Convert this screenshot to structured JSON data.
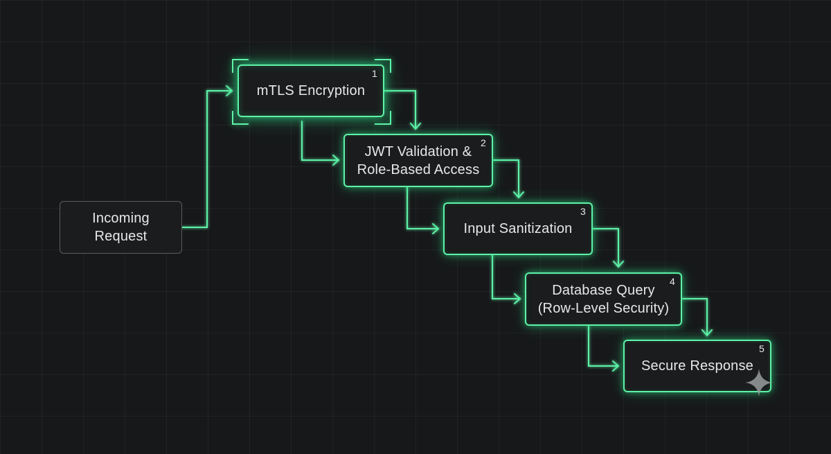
{
  "diagram": {
    "nodes": [
      {
        "id": "incoming",
        "label": "Incoming\nRequest",
        "number": ""
      },
      {
        "id": "mtls",
        "label": "mTLS Encryption",
        "number": "1"
      },
      {
        "id": "jwt",
        "label": "JWT Validation &\nRole-Based Access",
        "number": "2"
      },
      {
        "id": "sanitize",
        "label": "Input Sanitization",
        "number": "3"
      },
      {
        "id": "db",
        "label": "Database Query\n(Row-Level Security)",
        "number": "4"
      },
      {
        "id": "response",
        "label": "Secure Response",
        "number": "5"
      }
    ],
    "edges": [
      {
        "from": "incoming",
        "to": "mtls"
      },
      {
        "from": "mtls",
        "to": "jwt"
      },
      {
        "from": "mtls",
        "to": "jwt"
      },
      {
        "from": "jwt",
        "to": "sanitize"
      },
      {
        "from": "jwt",
        "to": "sanitize"
      },
      {
        "from": "sanitize",
        "to": "db"
      },
      {
        "from": "sanitize",
        "to": "db"
      },
      {
        "from": "db",
        "to": "response"
      },
      {
        "from": "db",
        "to": "response"
      }
    ],
    "colors": {
      "accent": "#5ff2a8",
      "background": "#17181a",
      "text": "#e6e8ea",
      "neutral_border": "#5a5d60"
    }
  },
  "icons": {
    "watermark": "sparkle-icon"
  }
}
